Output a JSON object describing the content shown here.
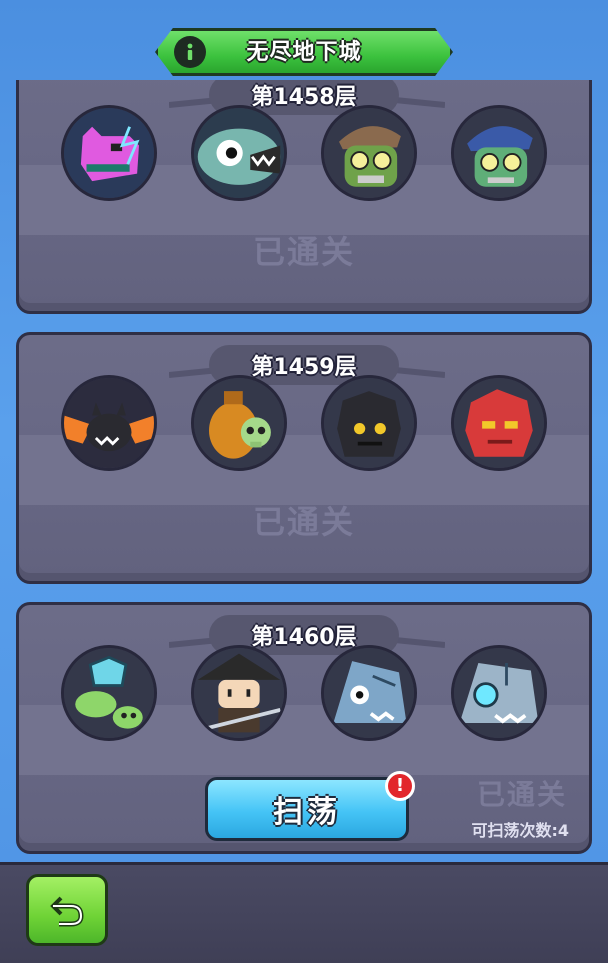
{
  "header": {
    "title": "无尽地下城",
    "info_icon": "info-icon"
  },
  "floors": [
    {
      "label": "第1458层",
      "status": "已通关",
      "monsters": [
        "pink-dog-monster-icon",
        "teal-fish-monster-icon",
        "brown-cap-zombie-icon",
        "blue-cap-zombie-icon"
      ]
    },
    {
      "label": "第1459层",
      "status": "已通关",
      "monsters": [
        "flame-bat-monster-icon",
        "skull-jar-monster-icon",
        "black-rock-golem-icon",
        "red-rock-golem-icon"
      ]
    },
    {
      "label": "第1460层",
      "status": "已通关",
      "monsters": [
        "green-fly-monster-icon",
        "straw-hat-ninja-icon",
        "shark-zombie-icon",
        "cyborg-shark-icon"
      ],
      "sweep_button": "扫荡",
      "sweep_count_text": "可扫荡次数:4",
      "alert_badge": "!"
    }
  ],
  "footer": {
    "back_icon": "return-arrow-icon"
  },
  "colors": {
    "title_green": "#3cc23e",
    "panel": "#6c6c88",
    "sweep_blue": "#45c4f6",
    "alert_red": "#e2262b",
    "back_green": "#6fd336"
  }
}
